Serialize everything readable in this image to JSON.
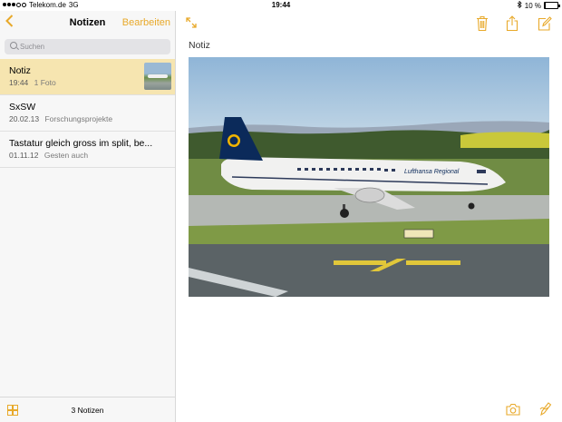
{
  "status": {
    "carrier": "Telekom.de",
    "network": "3G",
    "time": "19:44",
    "battery": "10 %",
    "battery_level": 0.1
  },
  "sidebar": {
    "title": "Notizen",
    "edit_label": "Bearbeiten",
    "search_placeholder": "Suchen",
    "notes": [
      {
        "title": "Notiz",
        "date": "19:44",
        "preview": "1 Foto",
        "has_thumbnail": true,
        "selected": true
      },
      {
        "title": "SxSW",
        "date": "20.02.13",
        "preview": "Forschungsprojekte",
        "has_thumbnail": false,
        "selected": false
      },
      {
        "title": "Tastatur gleich gross im split, be...",
        "date": "01.11.12",
        "preview": "Gesten auch",
        "has_thumbnail": false,
        "selected": false
      }
    ],
    "note_count": "3 Notizen"
  },
  "detail": {
    "heading": "Notiz",
    "photo_airline_text": "Lufthansa Regional"
  },
  "icons": {
    "back": "chevron-left-icon",
    "expand": "expand-icon",
    "trash": "trash-icon",
    "share": "share-icon",
    "compose": "compose-icon",
    "camera": "camera-icon",
    "sketch": "sketch-icon",
    "grid": "grid-icon"
  },
  "colors": {
    "accent": "#e8a92a",
    "selected_row": "#f6e5b0"
  }
}
